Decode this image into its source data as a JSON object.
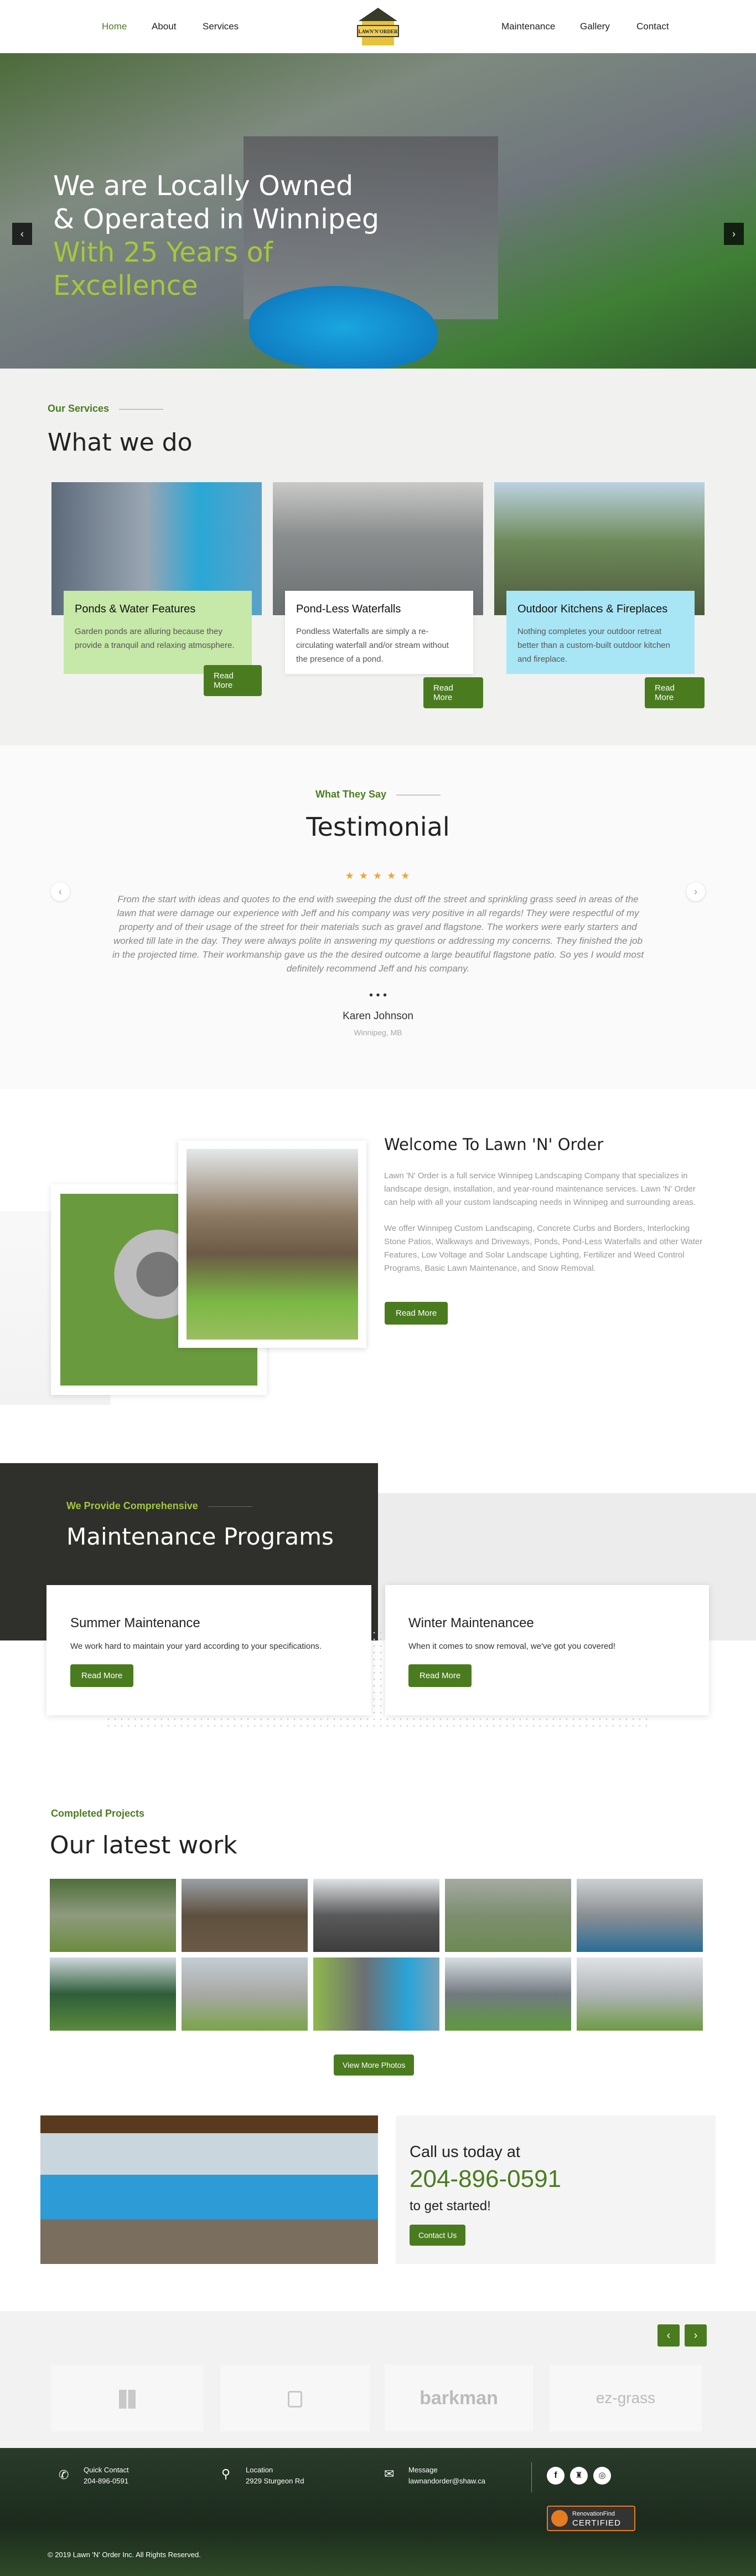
{
  "nav": {
    "left": [
      "Home",
      "About",
      "Services"
    ],
    "right": [
      "Maintenance",
      "Gallery",
      "Contact"
    ],
    "logo_text": "LAWN 'N' ORDER"
  },
  "hero": {
    "line1": "We are Locally Owned",
    "line2": "& Operated in Winnipeg",
    "line3": "With 25 Years of",
    "line4": "Excellence",
    "prev": "‹",
    "next": "›"
  },
  "services": {
    "label": "Our Services",
    "title": "What we do",
    "items": [
      {
        "title": "Ponds & Water Features",
        "text": "Garden ponds are alluring because they provide a tranquil and relaxing atmosphere.",
        "button": "Read More",
        "bg": "#c6e8a8"
      },
      {
        "title": "Pond-Less Waterfalls",
        "text": "Pondless Waterfalls are simply a re-circulating waterfall and/or stream without the presence of a pond.",
        "button": "Read More",
        "bg": "#ffffff"
      },
      {
        "title": "Outdoor Kitchens & Fireplaces",
        "text": "Nothing completes your outdoor retreat better than a custom-built outdoor kitchen and fireplace.",
        "button": "Read More",
        "bg": "#a9e6f5"
      }
    ]
  },
  "testimonial": {
    "label": "What They Say",
    "title": "Testimonial",
    "stars": "★ ★ ★ ★ ★",
    "quote": "From the start with ideas and quotes to the end with sweeping the dust off the street and sprinkling grass seed in areas of the lawn that were damage our experience with Jeff and his company was very positive in all regards! They were respectful of my property and of their usage of the street for their materials such as gravel and flagstone. The workers were early starters and worked till late in the day. They were always polite in answering my questions or addressing my concerns. They finished the job in the projected time. Their workmanship gave us the the desired outcome a large beautiful flagstone patio. So yes I would most definitely recommend Jeff and his company.",
    "dots": "• • •",
    "name": "Karen Johnson",
    "location": "Winnipeg, MB",
    "prev": "‹",
    "next": "›"
  },
  "welcome": {
    "title": "Welcome To Lawn 'N' Order",
    "p1": "Lawn 'N' Order is a full service Winnipeg Landscaping Company that specializes in landscape design, installation, and year-round maintenance services. Lawn 'N' Order can help with all your custom landscaping needs in Winnipeg and surrounding areas.",
    "p2": "We offer Winnipeg Custom Landscaping, Concrete Curbs and Borders, Interlocking Stone Patios, Walkways and Driveways, Ponds, Pond-Less Waterfalls and other Water Features, Low Voltage and Solar Landscape Lighting, Fertilizer and Weed Control Programs, Basic Lawn Maintenance, and Snow Removal.",
    "button": "Read More"
  },
  "maintenance": {
    "label": "We Provide Comprehensive",
    "title": "Maintenance Programs",
    "cards": [
      {
        "title": "Summer Maintenance",
        "text": "We work hard to maintain your yard according to your specifications.",
        "button": "Read More"
      },
      {
        "title": "Winter Maintenancee",
        "text": "When it comes to snow removal, we've got you covered!",
        "button": "Read More"
      }
    ]
  },
  "projects": {
    "label": "Completed Projects",
    "title": "Our latest work",
    "button": "View More Photos"
  },
  "cta": {
    "line1": "Call us today at",
    "phone": "204-896-0591",
    "line3": "to get started!",
    "button": "Contact Us"
  },
  "partners": {
    "logos": [
      "",
      "",
      "barkman",
      "ez-grass"
    ],
    "prev": "‹",
    "next": "›"
  },
  "footer": {
    "contact_label": "Quick Contact",
    "contact_value": "204-896-0591",
    "location_label": "Location",
    "location_value": "2929 Sturgeon Rd",
    "message_label": "Message",
    "message_value": "lawnandorder@shaw.ca",
    "badge_top": "RenovationFind",
    "badge_bottom": "CERTIFIED",
    "copyright": "© 2019 Lawn 'N' Order Inc. All Rights Reserved."
  },
  "colors": {
    "accent": "#4a7c1f",
    "hero_highlight": "#a3c93a",
    "dark_panel": "#2f2f2b"
  }
}
